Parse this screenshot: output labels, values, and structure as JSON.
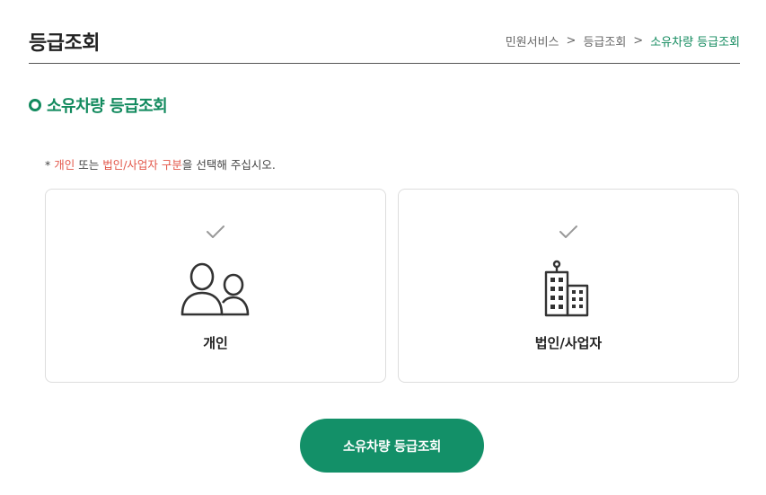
{
  "header": {
    "title": "등급조회",
    "breadcrumb": {
      "items": [
        "민원서비스",
        "등급조회"
      ],
      "current": "소유차량 등급조회",
      "separator": ">"
    }
  },
  "section": {
    "title": "소유차량 등급조회"
  },
  "notice": {
    "prefix": "* ",
    "hl1": "개인",
    "mid": " 또는 ",
    "hl2": "법인/사업자 구분",
    "suffix": "을 선택해 주십시오."
  },
  "options": {
    "personal": {
      "label": "개인",
      "icon": "people-icon"
    },
    "corporate": {
      "label": "법인/사업자",
      "icon": "building-icon"
    }
  },
  "submit": {
    "label": "소유차량 등급조회"
  },
  "colors": {
    "accent": "#128a5e",
    "button": "#139068",
    "highlight": "#e3574a",
    "check": "#999999"
  }
}
